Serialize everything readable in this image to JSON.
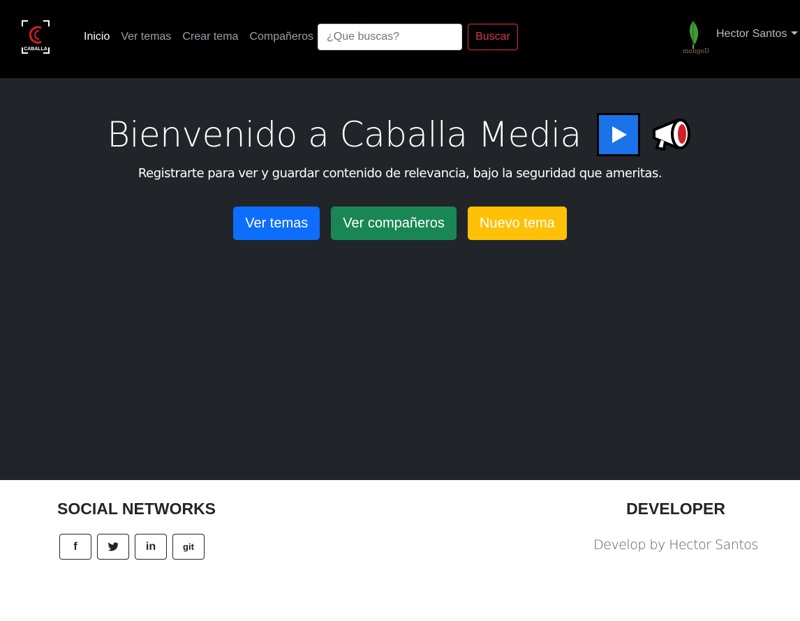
{
  "navbar": {
    "logo_text": "CABALLA",
    "links": [
      {
        "label": "Inicio",
        "active": true
      },
      {
        "label": "Ver temas",
        "active": false
      },
      {
        "label": "Crear tema",
        "active": false
      },
      {
        "label": "Compañeros",
        "active": false
      }
    ],
    "search": {
      "placeholder": "¿Que buscas?",
      "value": ""
    },
    "search_button": "Buscar",
    "mongo_label": "mongoDB",
    "user_name": "Hector Santos"
  },
  "hero": {
    "title": "Bienvenido a Caballa Media",
    "subtitle": "Registrarte para ver y guardar contenido de relevancia, bajo la seguridad que ameritas.",
    "buttons": {
      "topics": "Ver temas",
      "companions": "Ver compañeros",
      "new_topic": "Nuevo tema"
    }
  },
  "footer": {
    "social_title": "SOCIAL NETWORKS",
    "social": [
      {
        "icon": "facebook-icon",
        "label": "f"
      },
      {
        "icon": "twitter-icon",
        "label": ""
      },
      {
        "icon": "linkedin-icon",
        "label": "in"
      },
      {
        "icon": "git-icon",
        "label": "git"
      }
    ],
    "developer_title": "DEVELOPER",
    "developer_text": "Develop by Hector Santos"
  },
  "colors": {
    "navbar_bg": "#000000",
    "hero_bg": "#212529",
    "primary": "#0d6efd",
    "success": "#198754",
    "warning": "#ffc107",
    "danger": "#dc3545"
  }
}
